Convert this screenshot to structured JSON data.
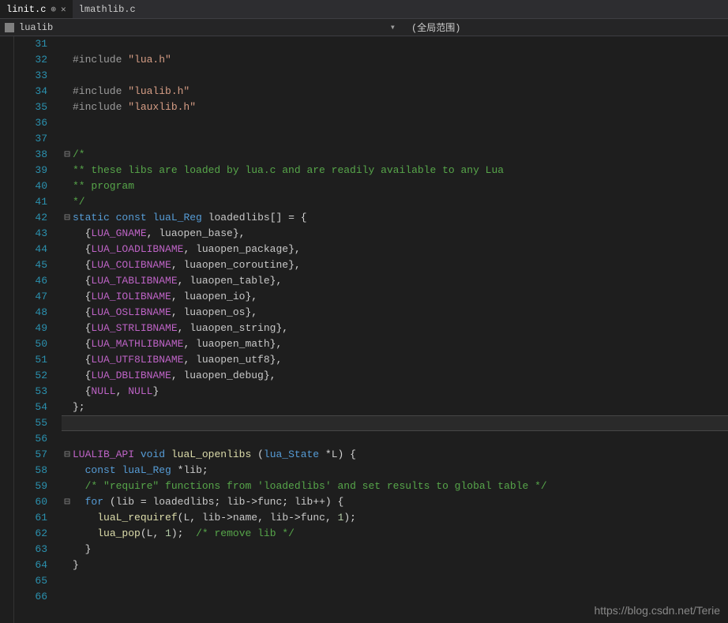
{
  "tabs": [
    {
      "label": "linit.c",
      "active": true
    },
    {
      "label": "lmathlib.c",
      "active": false
    }
  ],
  "nav": {
    "symbol": "lualib",
    "scope": "(全局范围)"
  },
  "watermark": "https://blog.csdn.net/Terie",
  "code": {
    "first_line": 31,
    "lines": [
      {
        "fold": "",
        "guides": 1,
        "tokens": []
      },
      {
        "fold": "",
        "guides": 1,
        "tokens": [
          [
            "include",
            "#include "
          ],
          [
            "string",
            "\"lua.h\""
          ]
        ]
      },
      {
        "fold": "",
        "guides": 1,
        "tokens": []
      },
      {
        "fold": "",
        "guides": 1,
        "tokens": [
          [
            "include",
            "#include "
          ],
          [
            "string",
            "\"lualib.h\""
          ]
        ]
      },
      {
        "fold": "",
        "guides": 1,
        "tokens": [
          [
            "include",
            "#include "
          ],
          [
            "string",
            "\"lauxlib.h\""
          ]
        ]
      },
      {
        "fold": "",
        "guides": 0,
        "tokens": []
      },
      {
        "fold": "",
        "guides": 0,
        "tokens": []
      },
      {
        "fold": "⊟",
        "guides": 0,
        "tokens": [
          [
            "comment",
            "/*"
          ]
        ]
      },
      {
        "fold": "",
        "guides": 1,
        "tokens": [
          [
            "comment",
            "** these libs are loaded by lua.c and are readily available to any Lua"
          ]
        ]
      },
      {
        "fold": "",
        "guides": 1,
        "tokens": [
          [
            "comment",
            "** program"
          ]
        ]
      },
      {
        "fold": "",
        "guides": 1,
        "tokens": [
          [
            "comment",
            "*/"
          ]
        ]
      },
      {
        "fold": "⊟",
        "guides": 0,
        "tokens": [
          [
            "keyword",
            "static"
          ],
          [
            "punc",
            " "
          ],
          [
            "keyword",
            "const"
          ],
          [
            "punc",
            " "
          ],
          [
            "type",
            "luaL_Reg"
          ],
          [
            "punc",
            " "
          ],
          [
            "var",
            "loadedlibs"
          ],
          [
            "punc",
            "[] = {"
          ]
        ]
      },
      {
        "fold": "",
        "guides": 1,
        "tokens": [
          [
            "punc",
            "  {"
          ],
          [
            "macro",
            "LUA_GNAME"
          ],
          [
            "punc",
            ", "
          ],
          [
            "var",
            "luaopen_base"
          ],
          [
            "punc",
            "},"
          ]
        ]
      },
      {
        "fold": "",
        "guides": 1,
        "tokens": [
          [
            "punc",
            "  {"
          ],
          [
            "macro",
            "LUA_LOADLIBNAME"
          ],
          [
            "punc",
            ", "
          ],
          [
            "var",
            "luaopen_package"
          ],
          [
            "punc",
            "},"
          ]
        ]
      },
      {
        "fold": "",
        "guides": 1,
        "tokens": [
          [
            "punc",
            "  {"
          ],
          [
            "macro",
            "LUA_COLIBNAME"
          ],
          [
            "punc",
            ", "
          ],
          [
            "var",
            "luaopen_coroutine"
          ],
          [
            "punc",
            "},"
          ]
        ]
      },
      {
        "fold": "",
        "guides": 1,
        "tokens": [
          [
            "punc",
            "  {"
          ],
          [
            "macro",
            "LUA_TABLIBNAME"
          ],
          [
            "punc",
            ", "
          ],
          [
            "var",
            "luaopen_table"
          ],
          [
            "punc",
            "},"
          ]
        ]
      },
      {
        "fold": "",
        "guides": 1,
        "tokens": [
          [
            "punc",
            "  {"
          ],
          [
            "macro",
            "LUA_IOLIBNAME"
          ],
          [
            "punc",
            ", "
          ],
          [
            "var",
            "luaopen_io"
          ],
          [
            "punc",
            "},"
          ]
        ]
      },
      {
        "fold": "",
        "guides": 1,
        "tokens": [
          [
            "punc",
            "  {"
          ],
          [
            "macro",
            "LUA_OSLIBNAME"
          ],
          [
            "punc",
            ", "
          ],
          [
            "var",
            "luaopen_os"
          ],
          [
            "punc",
            "},"
          ]
        ]
      },
      {
        "fold": "",
        "guides": 1,
        "tokens": [
          [
            "punc",
            "  {"
          ],
          [
            "macro",
            "LUA_STRLIBNAME"
          ],
          [
            "punc",
            ", "
          ],
          [
            "var",
            "luaopen_string"
          ],
          [
            "punc",
            "},"
          ]
        ]
      },
      {
        "fold": "",
        "guides": 1,
        "tokens": [
          [
            "punc",
            "  {"
          ],
          [
            "macro",
            "LUA_MATHLIBNAME"
          ],
          [
            "punc",
            ", "
          ],
          [
            "var",
            "luaopen_math"
          ],
          [
            "punc",
            "},"
          ]
        ]
      },
      {
        "fold": "",
        "guides": 1,
        "tokens": [
          [
            "punc",
            "  {"
          ],
          [
            "macro",
            "LUA_UTF8LIBNAME"
          ],
          [
            "punc",
            ", "
          ],
          [
            "var",
            "luaopen_utf8"
          ],
          [
            "punc",
            "},"
          ]
        ]
      },
      {
        "fold": "",
        "guides": 1,
        "tokens": [
          [
            "punc",
            "  {"
          ],
          [
            "macro",
            "LUA_DBLIBNAME"
          ],
          [
            "punc",
            ", "
          ],
          [
            "var",
            "luaopen_debug"
          ],
          [
            "punc",
            "},"
          ]
        ]
      },
      {
        "fold": "",
        "guides": 1,
        "tokens": [
          [
            "punc",
            "  {"
          ],
          [
            "macro",
            "NULL"
          ],
          [
            "punc",
            ", "
          ],
          [
            "macro",
            "NULL"
          ],
          [
            "punc",
            "}"
          ]
        ]
      },
      {
        "fold": "",
        "guides": 1,
        "tokens": [
          [
            "punc",
            "};"
          ]
        ]
      },
      {
        "fold": "",
        "guides": 0,
        "tokens": [],
        "highlight": true
      },
      {
        "fold": "",
        "guides": 0,
        "tokens": []
      },
      {
        "fold": "⊟",
        "guides": 0,
        "tokens": [
          [
            "macro",
            "LUALIB_API"
          ],
          [
            "punc",
            " "
          ],
          [
            "keyword",
            "void"
          ],
          [
            "punc",
            " "
          ],
          [
            "func",
            "luaL_openlibs"
          ],
          [
            "punc",
            " ("
          ],
          [
            "type",
            "lua_State"
          ],
          [
            "punc",
            " *"
          ],
          [
            "var",
            "L"
          ],
          [
            "punc",
            ") {"
          ]
        ]
      },
      {
        "fold": "",
        "guides": 1,
        "tokens": [
          [
            "punc",
            "  "
          ],
          [
            "keyword",
            "const"
          ],
          [
            "punc",
            " "
          ],
          [
            "type",
            "luaL_Reg"
          ],
          [
            "punc",
            " *"
          ],
          [
            "var",
            "lib"
          ],
          [
            "punc",
            ";"
          ]
        ]
      },
      {
        "fold": "",
        "guides": 1,
        "tokens": [
          [
            "punc",
            "  "
          ],
          [
            "comment",
            "/* \"require\" functions from 'loadedlibs' and set results to global table */"
          ]
        ]
      },
      {
        "fold": "⊟",
        "guides": 1,
        "tokens": [
          [
            "punc",
            "  "
          ],
          [
            "keyword",
            "for"
          ],
          [
            "punc",
            " ("
          ],
          [
            "var",
            "lib"
          ],
          [
            "punc",
            " = "
          ],
          [
            "var",
            "loadedlibs"
          ],
          [
            "punc",
            "; "
          ],
          [
            "var",
            "lib"
          ],
          [
            "punc",
            "->"
          ],
          [
            "var",
            "func"
          ],
          [
            "punc",
            "; "
          ],
          [
            "var",
            "lib"
          ],
          [
            "punc",
            "++) {"
          ]
        ]
      },
      {
        "fold": "",
        "guides": 2,
        "tokens": [
          [
            "punc",
            "    "
          ],
          [
            "func",
            "luaL_requiref"
          ],
          [
            "punc",
            "("
          ],
          [
            "var",
            "L"
          ],
          [
            "punc",
            ", "
          ],
          [
            "var",
            "lib"
          ],
          [
            "punc",
            "->"
          ],
          [
            "var",
            "name"
          ],
          [
            "punc",
            ", "
          ],
          [
            "var",
            "lib"
          ],
          [
            "punc",
            "->"
          ],
          [
            "var",
            "func"
          ],
          [
            "punc",
            ", "
          ],
          [
            "num",
            "1"
          ],
          [
            "punc",
            ");"
          ]
        ]
      },
      {
        "fold": "",
        "guides": 2,
        "tokens": [
          [
            "punc",
            "    "
          ],
          [
            "func",
            "lua_pop"
          ],
          [
            "punc",
            "("
          ],
          [
            "var",
            "L"
          ],
          [
            "punc",
            ", "
          ],
          [
            "num",
            "1"
          ],
          [
            "punc",
            ");  "
          ],
          [
            "comment",
            "/* remove lib */"
          ]
        ]
      },
      {
        "fold": "",
        "guides": 2,
        "tokens": [
          [
            "punc",
            "  }"
          ]
        ]
      },
      {
        "fold": "",
        "guides": 1,
        "tokens": [
          [
            "punc",
            "}"
          ]
        ]
      },
      {
        "fold": "",
        "guides": 0,
        "tokens": []
      },
      {
        "fold": "",
        "guides": 0,
        "tokens": []
      }
    ]
  }
}
